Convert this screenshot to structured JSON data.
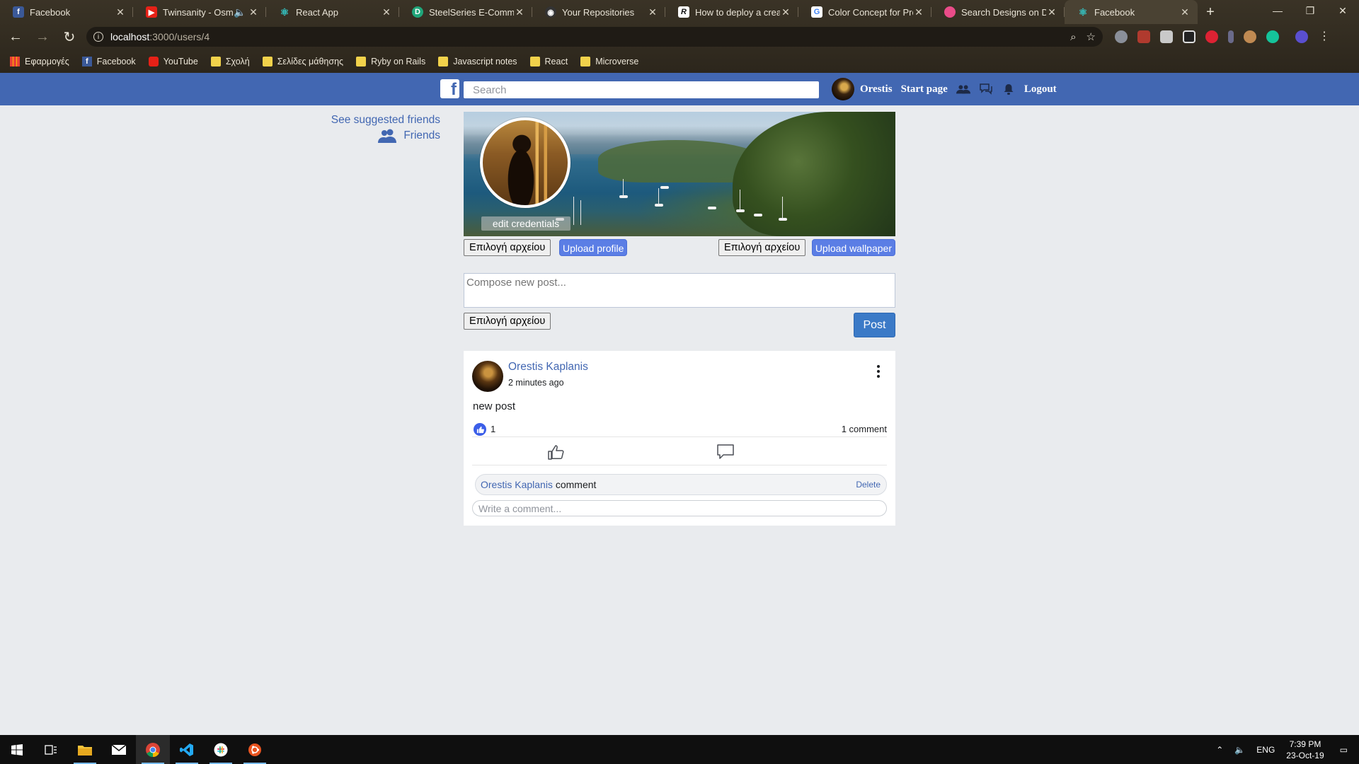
{
  "browser": {
    "tabs": [
      {
        "title": "Facebook",
        "favicon": "facebook-f",
        "color": "#3b5998"
      },
      {
        "title": "Twinsanity - Osmo",
        "favicon": "youtube-play",
        "color": "#e62117",
        "muted_icon": "speaker-icon"
      },
      {
        "title": "React App",
        "favicon": "react-atom",
        "color": "#1b8a8a"
      },
      {
        "title": "SteelSeries E-Commerce",
        "favicon": "d-letter",
        "color": "#1fa67a"
      },
      {
        "title": "Your Repositories",
        "favicon": "github-octocat",
        "color": "#333333"
      },
      {
        "title": "How to deploy a create",
        "favicon": "r-letter",
        "color": "#111111"
      },
      {
        "title": "Color Concept for Prof",
        "favicon": "google-g",
        "color": "#ffffff"
      },
      {
        "title": "Search Designs on Dribbble",
        "favicon": "dribbble-ball",
        "color": "#ea4c89"
      },
      {
        "title": "Facebook",
        "favicon": "react-atom",
        "color": "#1b8a8a",
        "active": true
      }
    ],
    "url_host": "localhost",
    "url_path": ":3000/users/4",
    "bookmarks": [
      {
        "label": "Εφαρμογές",
        "icon": "apps-grid"
      },
      {
        "label": "Facebook",
        "icon": "facebook-f"
      },
      {
        "label": "YouTube",
        "icon": "youtube-play"
      },
      {
        "label": "Σχολή",
        "icon": "folder"
      },
      {
        "label": "Σελίδες μάθησης",
        "icon": "folder"
      },
      {
        "label": "Ryby on Rails",
        "icon": "folder"
      },
      {
        "label": "Javascript notes",
        "icon": "folder"
      },
      {
        "label": "React",
        "icon": "folder"
      },
      {
        "label": "Microverse",
        "icon": "folder"
      }
    ]
  },
  "header": {
    "logo": "f",
    "search_placeholder": "Search",
    "user_name": "Orestis",
    "start_page": "Start page",
    "logout": "Logout",
    "brand_color": "#4267b2"
  },
  "sidebar": {
    "suggested": "See suggested friends",
    "friends": "Friends"
  },
  "profile": {
    "edit_credentials": "edit credentials",
    "choose_file": "Επιλογή αρχείου",
    "upload_profile": "Upload profile",
    "upload_wallpaper": "Upload wallpaper"
  },
  "composer": {
    "placeholder": "Compose new post...",
    "choose_file": "Επιλογή αρχείου",
    "post": "Post"
  },
  "post": {
    "author": "Orestis Kaplanis",
    "time": "2 minutes ago",
    "body": "new post",
    "likes": "1",
    "comments": "1 comment",
    "comment": {
      "author": "Orestis Kaplanis",
      "text": "comment",
      "delete": "Delete"
    },
    "write_placeholder": "Write a comment..."
  },
  "taskbar": {
    "language": "ENG",
    "time": "7:39 PM",
    "date": "23-Oct-19"
  }
}
